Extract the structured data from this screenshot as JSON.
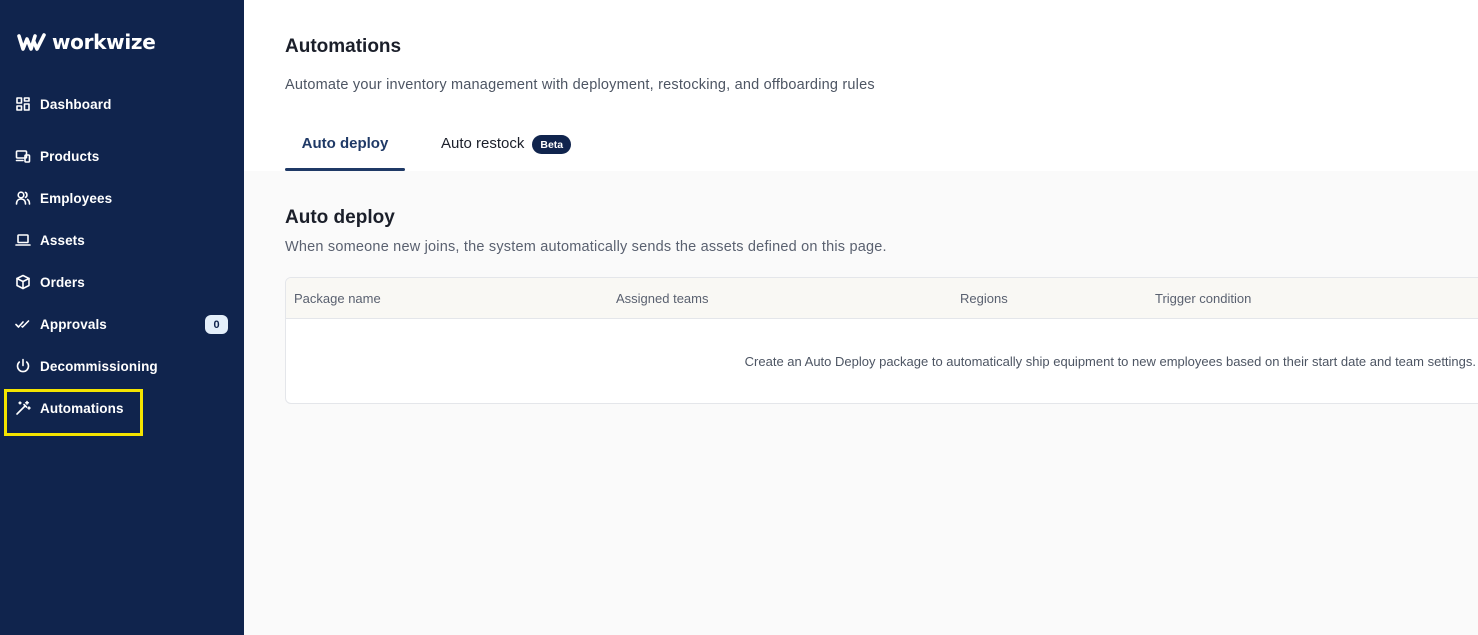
{
  "brand": {
    "name": "workwize"
  },
  "sidebar": {
    "items": [
      {
        "label": "Dashboard",
        "icon": "dashboard-grid-icon"
      },
      {
        "label": "Products",
        "icon": "devices-icon"
      },
      {
        "label": "Employees",
        "icon": "users-icon"
      },
      {
        "label": "Assets",
        "icon": "laptop-icon"
      },
      {
        "label": "Orders",
        "icon": "package-icon"
      },
      {
        "label": "Approvals",
        "icon": "check-double-icon",
        "badge": "0"
      },
      {
        "label": "Decommissioning",
        "icon": "power-icon"
      },
      {
        "label": "Automations",
        "icon": "magic-wand-icon",
        "active": true
      }
    ]
  },
  "header": {
    "title": "Automations",
    "subtitle": "Automate your inventory management with deployment, restocking, and offboarding rules"
  },
  "tabs": [
    {
      "label": "Auto deploy",
      "active": true
    },
    {
      "label": "Auto restock",
      "badge": "Beta"
    }
  ],
  "section": {
    "title": "Auto deploy",
    "subtitle": "When someone new joins, the system automatically sends the assets defined on this page."
  },
  "table": {
    "columns": [
      "Package name",
      "Assigned teams",
      "Regions",
      "Trigger condition"
    ],
    "empty_message": "Create an Auto Deploy package to automatically ship equipment to new employees based on their start date and team settings."
  },
  "colors": {
    "sidebar_bg": "#10244d",
    "accent": "#1f3966",
    "highlight": "#f4e400",
    "content_bg": "#fafafa"
  }
}
